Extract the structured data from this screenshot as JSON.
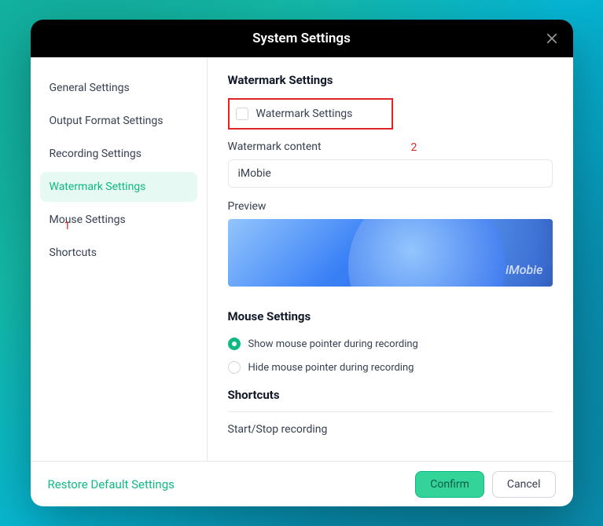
{
  "header": {
    "title": "System Settings"
  },
  "sidebar": {
    "items": [
      {
        "label": "General Settings"
      },
      {
        "label": "Output Format Settings"
      },
      {
        "label": "Recording Settings"
      },
      {
        "label": "Watermark Settings"
      },
      {
        "label": "Mouse Settings"
      },
      {
        "label": "Shortcuts"
      }
    ],
    "active_index": 3
  },
  "watermark": {
    "section_title": "Watermark Settings",
    "checkbox_label": "Watermark Settings",
    "content_label": "Watermark content",
    "content_value": "iMobie",
    "preview_label": "Preview",
    "preview_watermark": "iMobie"
  },
  "mouse": {
    "section_title": "Mouse Settings",
    "options": [
      {
        "label": "Show mouse pointer during recording",
        "selected": true
      },
      {
        "label": "Hide mouse pointer during recording",
        "selected": false
      }
    ]
  },
  "shortcuts": {
    "section_title": "Shortcuts",
    "items": [
      {
        "label": "Start/Stop recording"
      }
    ]
  },
  "footer": {
    "restore": "Restore Default Settings",
    "confirm": "Confirm",
    "cancel": "Cancel"
  },
  "annotations": {
    "a1": "1",
    "a2": "2"
  }
}
